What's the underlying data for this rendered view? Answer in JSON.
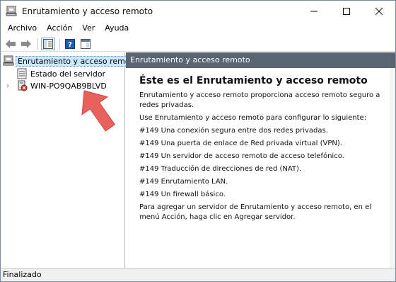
{
  "window": {
    "title": "Enrutamiento y acceso remoto"
  },
  "menu": {
    "items": [
      "Archivo",
      "Acción",
      "Ver",
      "Ayuda"
    ]
  },
  "toolbar": {
    "icons": [
      "back-arrow-icon",
      "forward-arrow-icon",
      "show-hide-tree-icon",
      "help-icon",
      "console-view-icon"
    ]
  },
  "tree": {
    "root_label": "Enrutamiento y acceso remoto",
    "child_status_label": "Estado del servidor",
    "child_server_label": "WIN-PO9QAB9BLVD"
  },
  "content": {
    "header": "Enrutamiento y acceso remoto",
    "heading": "Éste es el Enrutamiento y acceso remoto",
    "intro": "Enrutamiento y acceso remoto proporciona acceso remoto seguro a redes privadas.",
    "use_line": "Use Enrutamiento y acceso remoto para configurar lo siguiente:",
    "features": [
      "#149 Una conexión segura entre dos redes privadas.",
      "#149 Una puerta de enlace de Red privada virtual (VPN).",
      "#149 Un servidor de acceso remoto de acceso telefónico.",
      "#149 Traducción de direcciones de red (NAT).",
      "#149 Enrutamiento LAN.",
      "#149 Un firewall básico."
    ],
    "footer": "Para agregar un servidor de Enrutamiento y acceso remoto, en el menú Acción, haga clic en Agregar servidor."
  },
  "status": {
    "text": "Finalizado"
  },
  "colors": {
    "content_header_bg": "#5a6572",
    "selection_bg": "#cce8ff",
    "arrow": "#e8615c"
  }
}
